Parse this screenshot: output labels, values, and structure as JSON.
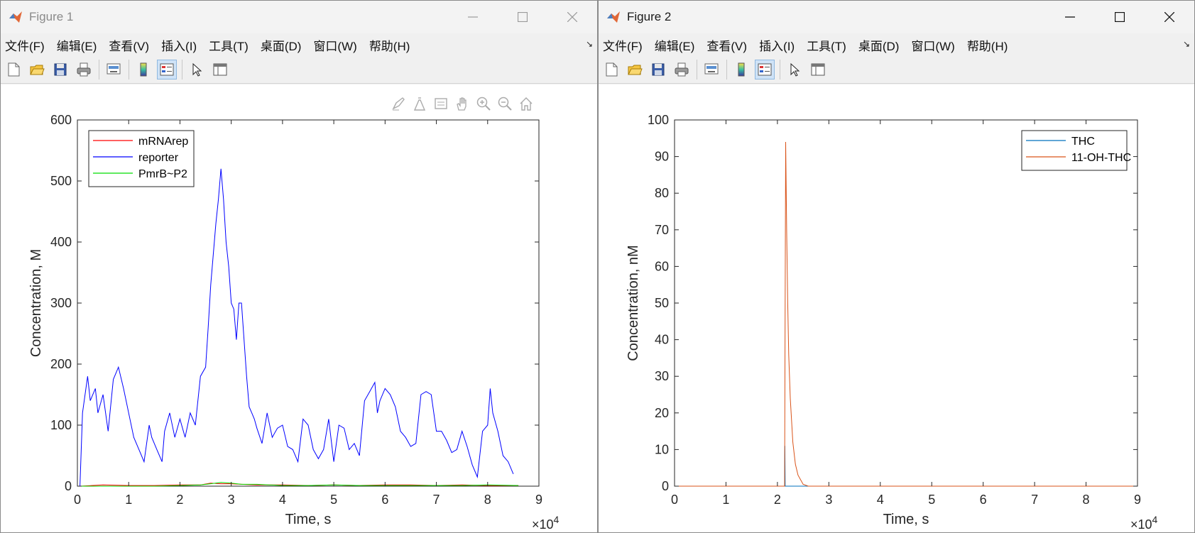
{
  "menu_items": [
    "文件(F)",
    "编辑(E)",
    "查看(V)",
    "插入(I)",
    "工具(T)",
    "桌面(D)",
    "窗口(W)",
    "帮助(H)"
  ],
  "menu_corner_glyph": "↘",
  "toolbar_icons": [
    "new-figure-icon",
    "open-file-icon",
    "save-icon",
    "print-icon",
    "link-plot-icon",
    "colorbar-icon",
    "legend-icon",
    "edit-plot-icon",
    "property-inspector-icon"
  ],
  "axes_toolbar_icons": [
    "brush-icon",
    "data-tips-icon",
    "datatip-table-icon",
    "pan-icon",
    "zoom-in-icon",
    "zoom-out-icon",
    "home-icon"
  ],
  "figure1": {
    "title": "Figure 1",
    "chart_data": {
      "type": "line",
      "xlabel": "Time, s",
      "ylabel": "Concentration, M",
      "x_exponent_base": "×10",
      "x_exponent_power": "4",
      "xlim": [
        0,
        9
      ],
      "ylim": [
        0,
        600
      ],
      "xticks": [
        0,
        1,
        2,
        3,
        4,
        5,
        6,
        7,
        8,
        9
      ],
      "yticks": [
        0,
        100,
        200,
        300,
        400,
        500,
        600
      ],
      "legend_position": "top-left",
      "series": [
        {
          "name": "mRNArep",
          "color": "#ff0000",
          "x": [
            0.05,
            0.5,
            1,
            1.5,
            2,
            2.4,
            2.6,
            2.8,
            3,
            3.2,
            3.5,
            4,
            4.5,
            5,
            5.5,
            6,
            6.5,
            7,
            7.5,
            8,
            8.6
          ],
          "y": [
            0,
            2,
            1,
            1,
            2,
            2,
            5,
            4,
            4,
            3,
            2,
            2,
            1,
            2,
            1,
            2,
            2,
            1,
            2,
            1,
            1
          ]
        },
        {
          "name": "reporter",
          "color": "#0000ff",
          "x": [
            0.05,
            0.1,
            0.2,
            0.25,
            0.35,
            0.4,
            0.5,
            0.6,
            0.7,
            0.8,
            0.9,
            1.0,
            1.1,
            1.2,
            1.3,
            1.4,
            1.45,
            1.55,
            1.65,
            1.7,
            1.8,
            1.9,
            2.0,
            2.1,
            2.2,
            2.3,
            2.4,
            2.5,
            2.55,
            2.6,
            2.65,
            2.7,
            2.75,
            2.8,
            2.85,
            2.9,
            2.95,
            3.0,
            3.05,
            3.1,
            3.15,
            3.2,
            3.25,
            3.3,
            3.35,
            3.4,
            3.45,
            3.5,
            3.6,
            3.7,
            3.8,
            3.9,
            4.0,
            4.1,
            4.2,
            4.3,
            4.4,
            4.5,
            4.6,
            4.7,
            4.8,
            4.9,
            5.0,
            5.1,
            5.2,
            5.3,
            5.4,
            5.5,
            5.6,
            5.7,
            5.8,
            5.85,
            5.9,
            6.0,
            6.1,
            6.2,
            6.3,
            6.4,
            6.5,
            6.6,
            6.7,
            6.8,
            6.9,
            7.0,
            7.1,
            7.2,
            7.3,
            7.4,
            7.5,
            7.6,
            7.7,
            7.8,
            7.9,
            8.0,
            8.05,
            8.1,
            8.2,
            8.3,
            8.4,
            8.5,
            8.6
          ],
          "y": [
            0,
            120,
            180,
            140,
            160,
            120,
            150,
            90,
            175,
            195,
            160,
            120,
            80,
            60,
            40,
            100,
            80,
            60,
            40,
            90,
            120,
            80,
            110,
            80,
            120,
            100,
            180,
            195,
            260,
            330,
            380,
            430,
            470,
            520,
            470,
            400,
            360,
            300,
            290,
            240,
            300,
            300,
            240,
            180,
            130,
            120,
            110,
            95,
            70,
            120,
            80,
            95,
            100,
            65,
            60,
            40,
            110,
            100,
            60,
            45,
            60,
            110,
            40,
            100,
            95,
            60,
            70,
            50,
            140,
            155,
            170,
            120,
            140,
            160,
            150,
            130,
            90,
            80,
            65,
            70,
            150,
            155,
            150,
            90,
            90,
            75,
            55,
            60,
            90,
            65,
            35,
            15,
            90,
            100,
            160,
            120,
            90,
            50,
            40,
            20
          ]
        },
        {
          "name": "PmrB~P2",
          "color": "#00dd00",
          "x": [
            0.05,
            0.5,
            1,
            1.5,
            2,
            2.4,
            2.6,
            2.8,
            3,
            3.2,
            3.5,
            4,
            4.5,
            5,
            5.5,
            6,
            6.5,
            7,
            7.5,
            8,
            8.6
          ],
          "y": [
            0,
            0,
            0,
            0,
            1,
            2,
            4,
            6,
            5,
            3,
            3,
            1,
            1,
            2,
            1,
            1,
            1,
            1,
            1,
            2,
            1
          ]
        }
      ]
    }
  },
  "figure2": {
    "title": "Figure 2",
    "chart_data": {
      "type": "line",
      "xlabel": "Time, s",
      "ylabel": "Concentration, nM",
      "x_exponent_base": "×10",
      "x_exponent_power": "4",
      "xlim": [
        0,
        9
      ],
      "ylim": [
        0,
        100
      ],
      "xticks": [
        0,
        1,
        2,
        3,
        4,
        5,
        6,
        7,
        8,
        9
      ],
      "yticks": [
        0,
        10,
        20,
        30,
        40,
        50,
        60,
        70,
        80,
        90,
        100
      ],
      "legend_position": "top-right",
      "series": [
        {
          "name": "THC",
          "color": "#0072bd",
          "x": [
            0,
            2.14,
            2.145,
            2.15,
            2.16,
            9
          ],
          "y": [
            0,
            0,
            11,
            0,
            0,
            0
          ]
        },
        {
          "name": "11-OH-THC",
          "color": "#d95319",
          "x": [
            0,
            2.14,
            2.16,
            2.18,
            2.2,
            2.22,
            2.25,
            2.3,
            2.35,
            2.4,
            2.5,
            2.6,
            9
          ],
          "y": [
            0,
            0,
            94,
            70,
            50,
            36,
            24,
            12,
            6,
            3,
            0.5,
            0,
            0
          ]
        }
      ]
    }
  }
}
